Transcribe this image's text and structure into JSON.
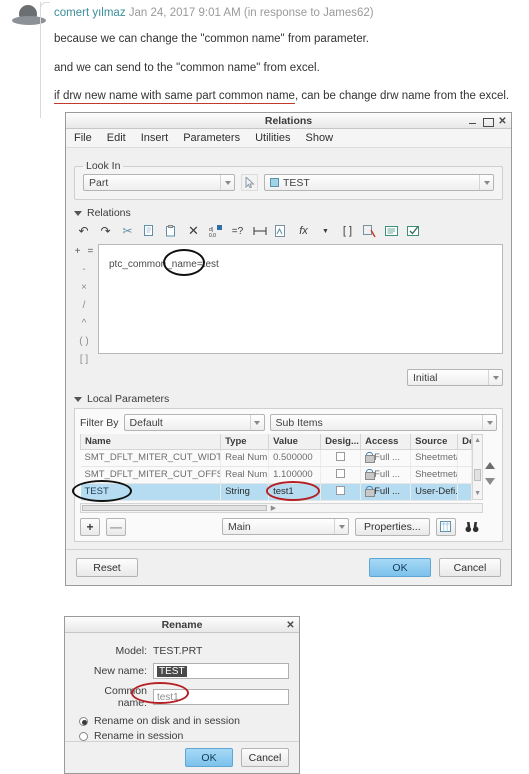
{
  "post": {
    "author": "comert yılmaz",
    "date_meta": "Jan 24, 2017 9:01 AM (in response to James62)",
    "line1": "because we can change the \"common name\" from parameter.",
    "line2": "and we can send to the \"common name\" from excel.",
    "line3_underlined": "if drw new name with same part common name",
    "line3_rest": ", can be change drw name from the excel."
  },
  "relations_dialog": {
    "title": "Relations",
    "window_buttons": {
      "minimize": "minimize-icon",
      "maximize": "maximize-icon",
      "close": "close-icon"
    },
    "menus": [
      "File",
      "Edit",
      "Insert",
      "Parameters",
      "Utilities",
      "Show"
    ],
    "look_in": {
      "legend": "Look In",
      "scope_value": "Part",
      "picker_icon": "pointer-icon",
      "model_value": "TEST"
    },
    "relations_section": {
      "label": "Relations",
      "toolbar": [
        "undo-icon",
        "redo-icon",
        "cut-icon",
        "copy-icon",
        "paste-icon",
        "delete-icon",
        "sort-icon",
        "verify-icon",
        "dimension-icon",
        "insert-from-file-icon",
        "function-icon",
        "units-icon",
        "parentheses-icon",
        "comment-icon",
        "display-icon",
        "check-icon"
      ],
      "operators": [
        "+",
        "=",
        "-",
        "×",
        "/",
        "^",
        "( )",
        "[ ]"
      ],
      "editor_text": "ptc_common_name=test",
      "mode_value": "Initial"
    },
    "local_parameters": {
      "label": "Local Parameters",
      "filter_label": "Filter By",
      "filter_value": "Default",
      "sub_items_label": "Sub Items",
      "sub_items_value": "",
      "columns": [
        "Name",
        "Type",
        "Value",
        "Desig...",
        "Access",
        "Source",
        "De"
      ],
      "rows": [
        {
          "name": "SMT_DFLT_MITER_CUT_WIDTH",
          "type": "Real Num...",
          "value": "0.500000",
          "designate": false,
          "access": "Full ...",
          "source": "Sheetmetal",
          "selected": false
        },
        {
          "name": "SMT_DFLT_MITER_CUT_OFFSET",
          "type": "Real Num...",
          "value": "1.100000",
          "designate": false,
          "access": "Full ...",
          "source": "Sheetmetal",
          "selected": false
        },
        {
          "name": "TEST",
          "type": "String",
          "value": "test1",
          "designate": false,
          "access": "Full ...",
          "source": "User-Defi...",
          "selected": true
        }
      ],
      "footer": {
        "add_label": "+",
        "remove_label": "—",
        "scope_value": "Main",
        "properties_label": "Properties...",
        "table_icon": "table-icon",
        "find_icon": "binoculars-icon"
      },
      "move_up_icon": "arrow-up-icon",
      "move_down_icon": "arrow-down-icon"
    },
    "footer": {
      "reset_label": "Reset",
      "ok_label": "OK",
      "cancel_label": "Cancel"
    }
  },
  "rename_dialog": {
    "title": "Rename",
    "close_icon": "close-icon",
    "model_label": "Model:",
    "model_value": "TEST.PRT",
    "new_name_label": "New name:",
    "new_name_value": "TEST",
    "common_name_label": "Common name:",
    "common_name_value": "test1",
    "options": [
      {
        "label": "Rename on disk and in session",
        "selected": true
      },
      {
        "label": "Rename in session",
        "selected": false
      }
    ],
    "ok_label": "OK",
    "cancel_label": "Cancel"
  },
  "annotations": {
    "black_ellipse_relation": "highlights ptc_common_name value in relation",
    "black_ellipse_param_name": "highlights TEST parameter name",
    "red_ellipse_param_value": "highlights test1 parameter value",
    "red_ellipse_common_name": "highlights test1 common name"
  },
  "colors": {
    "author_link": "#3a8e9a",
    "red_annotation": "#b52025",
    "black_annotation": "#111111",
    "selected_row": "#b6dcf2",
    "ok_button": "#7cc2ec"
  }
}
